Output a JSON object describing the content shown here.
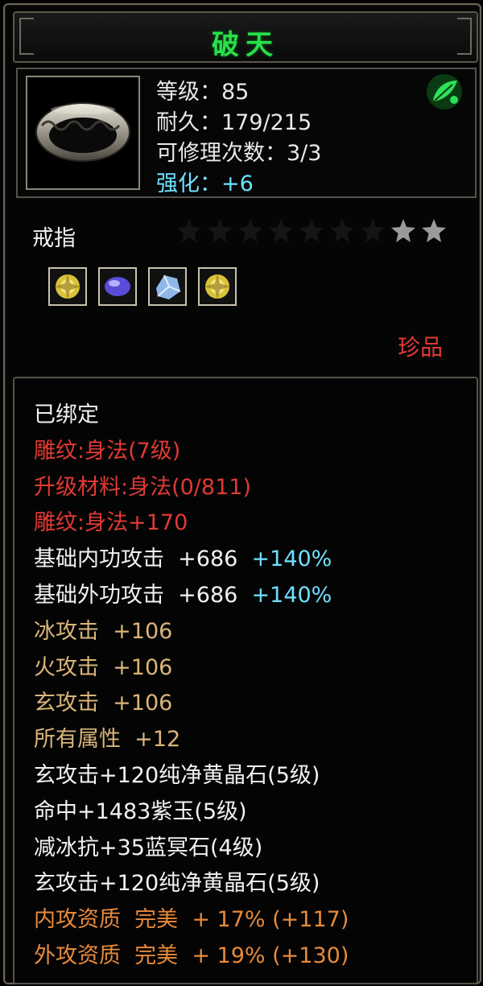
{
  "item": {
    "name": "破天",
    "level_line": "等级：85",
    "durability_line": "耐久：179/215",
    "repair_line": "可修理次数：3/3",
    "enhance_line": "强化：+6",
    "type": "戒指",
    "stars_total": 9,
    "stars_lit": 2,
    "rarity": "珍品"
  },
  "gems": [
    {
      "icon": "yellow-crystal-gem-icon",
      "color": "#d8c23a"
    },
    {
      "icon": "purple-jade-gem-icon",
      "color": "#6a5ce0"
    },
    {
      "icon": "blue-stone-gem-icon",
      "color": "#8fb8e8"
    },
    {
      "icon": "yellow-crystal-gem-icon",
      "color": "#d8c23a"
    }
  ],
  "attributes": {
    "bound": "已绑定",
    "engrave": "雕纹:身法(7级)",
    "upgrade_material": "升级材料:身法(0/811)",
    "engrave_bonus": "雕纹:身法+170",
    "inner_attack": {
      "label": "基础内功攻击",
      "value": "+686",
      "percent": "+140%"
    },
    "outer_attack": {
      "label": "基础外功攻击",
      "value": "+686",
      "percent": "+140%"
    },
    "ice_attack": {
      "label": "冰攻击",
      "value": "+106"
    },
    "fire_attack": {
      "label": "火攻击",
      "value": "+106"
    },
    "mystic_attack": {
      "label": "玄攻击",
      "value": "+106"
    },
    "all_attributes": {
      "label": "所有属性",
      "value": "+12"
    },
    "gem_line_1": "玄攻击+120纯净黄晶石(5级)",
    "gem_line_2": "命中+1483紫玉(5级)",
    "gem_line_3": "减冰抗+35蓝冥石(4级)",
    "gem_line_4": "玄攻击+120纯净黄晶石(5级)",
    "quality_inner": {
      "label": "内攻资质",
      "grade": "完美",
      "value": "+ 17% (+117)"
    },
    "quality_outer": {
      "label": "外攻资质",
      "grade": "完美",
      "value": "+ 19% (+130)"
    }
  },
  "colors": {
    "title": "#27e04a",
    "enhance": "#6fe0ff",
    "red": "#e03a34",
    "gold": "#d9b57a",
    "orange": "#e88a3a"
  }
}
